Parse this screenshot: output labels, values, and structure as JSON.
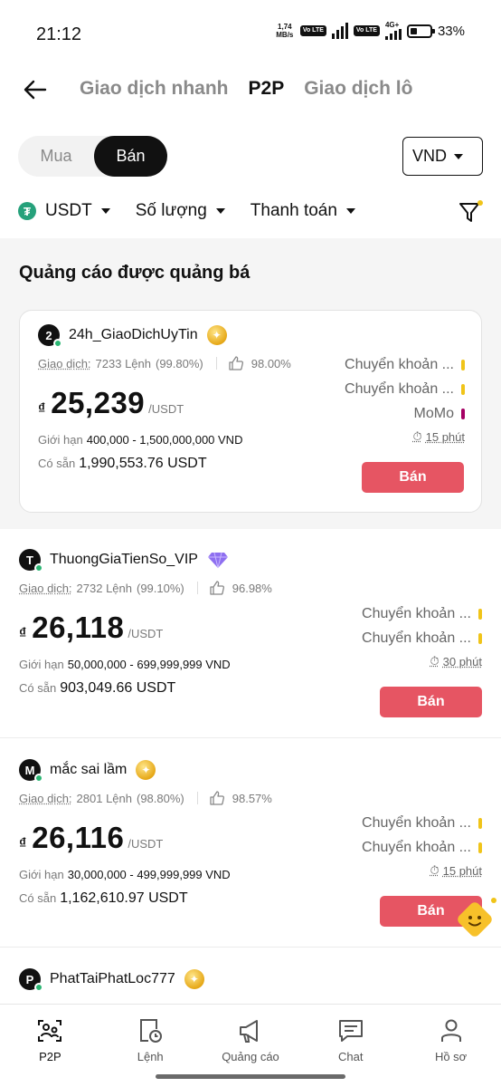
{
  "status_bar": {
    "time": "21:12",
    "net_speed_value": "1,74",
    "net_speed_unit": "MB/s",
    "volte1": "Vo LTE",
    "volte2": "Vo LTE",
    "network": "4G+",
    "battery": "33%"
  },
  "header": {
    "tabs": [
      "Giao dịch nhanh",
      "P2P",
      "Giao dịch lô"
    ],
    "active_tab": "P2P"
  },
  "toggle": {
    "buy_label": "Mua",
    "sell_label": "Bán",
    "selected": "Bán"
  },
  "currency": {
    "value": "VND"
  },
  "filters": {
    "asset": "USDT",
    "amount": "Số lượng",
    "payment": "Thanh toán"
  },
  "section": {
    "title": "Quảng cáo được quảng bá"
  },
  "ads": [
    {
      "avatar_letter": "2",
      "name": "24h_GiaoDichUyTin",
      "badge": "gold",
      "trades_label": "Giao dịch:",
      "trades": "7233 Lệnh",
      "completion": "(99.80%)",
      "rating": "98.00%",
      "currency_symbol": "₫",
      "price": "25,239",
      "unit": "/USDT",
      "limit_label": "Giới hạn",
      "limit": "400,000 - 1,500,000,000 VND",
      "available_label": "Có sẵn",
      "available": "1,990,553.76 USDT",
      "payments": [
        "Chuyển khoản ...",
        "Chuyển khoản ...",
        "MoMo"
      ],
      "time_limit": "15 phút",
      "action": "Bán"
    },
    {
      "avatar_letter": "T",
      "name": "ThuongGiaTienSo_VIP",
      "badge": "diamond",
      "trades_label": "Giao dịch:",
      "trades": "2732 Lệnh",
      "completion": "(99.10%)",
      "rating": "96.98%",
      "currency_symbol": "₫",
      "price": "26,118",
      "unit": "/USDT",
      "limit_label": "Giới hạn",
      "limit": "50,000,000 - 699,999,999 VND",
      "available_label": "Có sẵn",
      "available": "903,049.66 USDT",
      "payments": [
        "Chuyển khoản ...",
        "Chuyển khoản ..."
      ],
      "time_limit": "30 phút",
      "action": "Bán"
    },
    {
      "avatar_letter": "M",
      "name": "mắc sai lầm",
      "badge": "gold",
      "trades_label": "Giao dịch:",
      "trades": "2801 Lệnh",
      "completion": "(98.80%)",
      "rating": "98.57%",
      "currency_symbol": "₫",
      "price": "26,116",
      "unit": "/USDT",
      "limit_label": "Giới hạn",
      "limit": "30,000,000 - 499,999,999 VND",
      "available_label": "Có sẵn",
      "available": "1,162,610.97 USDT",
      "payments": [
        "Chuyển khoản ...",
        "Chuyển khoản ..."
      ],
      "time_limit": "15 phút",
      "action": "Bán"
    },
    {
      "avatar_letter": "P",
      "name": "PhatTaiPhatLoc777",
      "badge": "gold"
    }
  ],
  "bottom_nav": [
    {
      "label": "P2P",
      "icon": "p2p-icon",
      "active": true
    },
    {
      "label": "Lệnh",
      "icon": "orders-icon",
      "active": false
    },
    {
      "label": "Quảng cáo",
      "icon": "megaphone-icon",
      "active": false
    },
    {
      "label": "Chat",
      "icon": "chat-icon",
      "active": false
    },
    {
      "label": "Hồ sơ",
      "icon": "profile-icon",
      "active": false
    }
  ],
  "colors": {
    "sell_button": "#e65563",
    "online_dot": "#2bb673",
    "bank_bar": "#f0c419",
    "momo_bar": "#a50064",
    "usdt": "#26a17b"
  }
}
